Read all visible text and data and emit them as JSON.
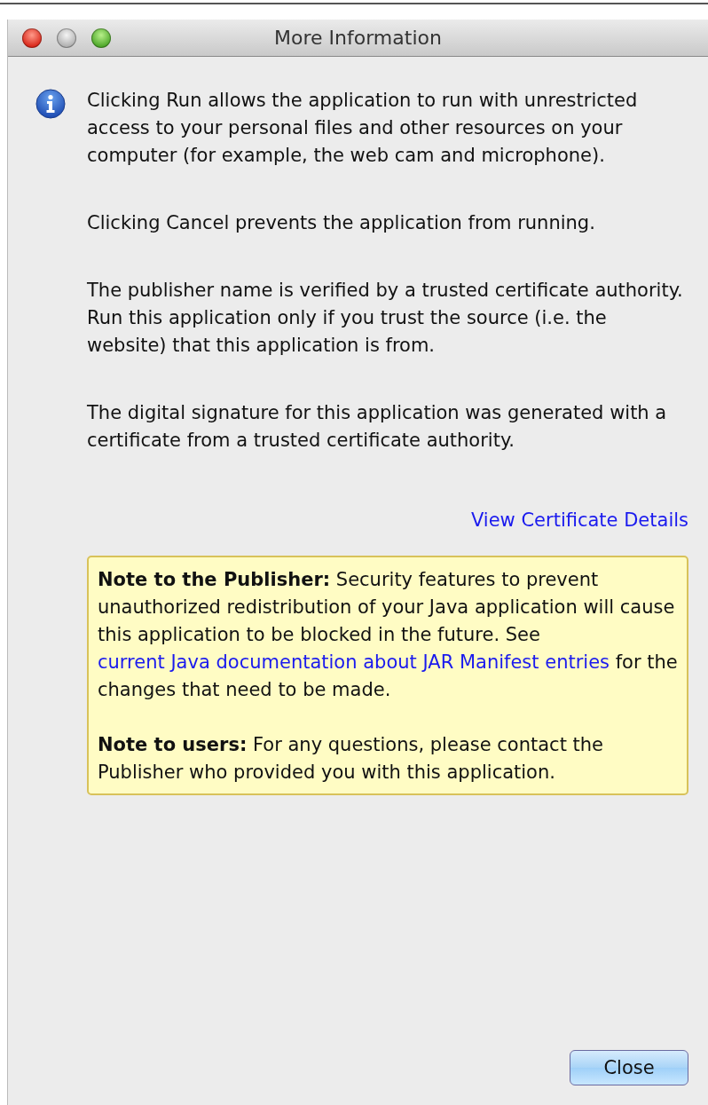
{
  "window": {
    "title": "More Information"
  },
  "paragraphs": [
    "Clicking Run allows the application to run with unrestricted access to your personal files and other resources on your computer (for example, the web cam and microphone).",
    "Clicking Cancel prevents the application from running.",
    "The publisher name is verified by a trusted certificate authority. Run this application only if you trust the source (i.e. the website) that this application is from.",
    "The digital signature for this application was generated with a certificate from a trusted certificate authority."
  ],
  "certificate_link": "View Certificate Details",
  "notes": [
    {
      "text_before": "**Note to the Publisher:** Security features to prevent unauthorized redistribution of your Java application will cause this application to be blocked in the future. See ",
      "link": "current Java documentation about JAR Manifest entries",
      "text_after": " for the changes that need to be made."
    },
    {
      "text_before": "**Note to users:** For any questions, please contact the Publisher who provided you with this application."
    }
  ],
  "buttons": [
    {
      "label": "Close",
      "default": true
    }
  ]
}
